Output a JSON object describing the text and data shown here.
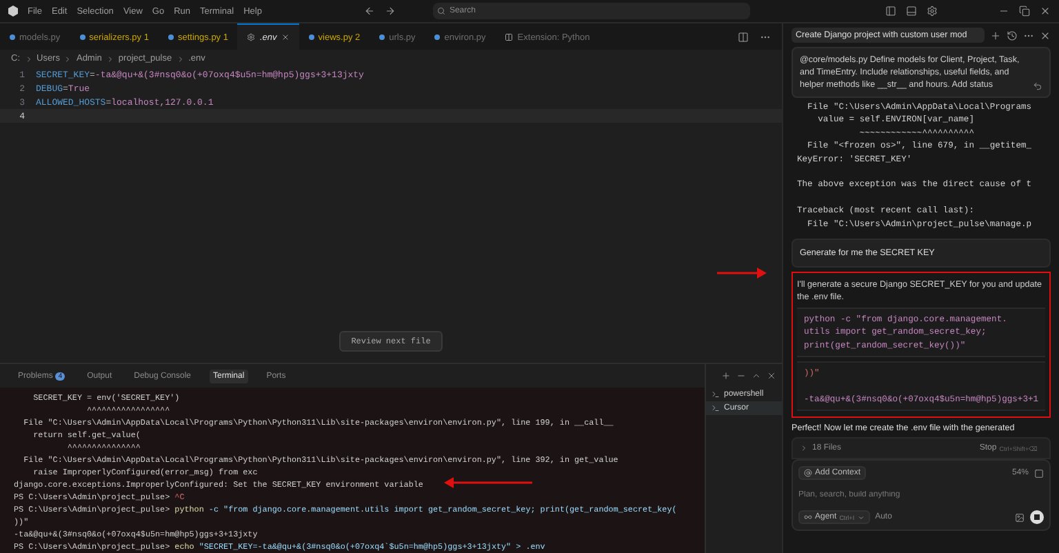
{
  "menu": [
    "File",
    "Edit",
    "Selection",
    "View",
    "Go",
    "Run",
    "Terminal",
    "Help"
  ],
  "search": {
    "placeholder": "Search"
  },
  "tabs": [
    {
      "label": "models.py",
      "kind": "dim",
      "selected": false
    },
    {
      "label": "serializers.py",
      "kind": "warning",
      "count": "1",
      "selected": false
    },
    {
      "label": "settings.py",
      "kind": "warning",
      "count": "1",
      "selected": false
    },
    {
      "label": ".env",
      "kind": "env",
      "selected": true
    },
    {
      "label": "views.py",
      "kind": "warning",
      "count": "2",
      "selected": false
    },
    {
      "label": "urls.py",
      "kind": "dim",
      "selected": false
    },
    {
      "label": "environ.py",
      "kind": "dim",
      "selected": false
    },
    {
      "label": "Extension: Python",
      "kind": "extension",
      "selected": false
    }
  ],
  "breadcrumb": [
    "C:",
    "Users",
    "Admin",
    "project_pulse",
    ".env"
  ],
  "editor_lines": [
    {
      "number": "1",
      "key": "SECRET_KEY",
      "separator": "=",
      "value": "-ta&@qu+&(3#nsq0&o(+07oxq4$u5n=hm@hp5)ggs+3+13jxty",
      "current": false
    },
    {
      "number": "2",
      "key": "DEBUG",
      "separator": "=",
      "value": "True",
      "current": false
    },
    {
      "number": "3",
      "key": "ALLOWED_HOSTS",
      "separator": "=",
      "value": "localhost,127.0.0.1",
      "current": false
    },
    {
      "number": "4",
      "current": true
    }
  ],
  "review_button": "Review next file",
  "panel_tabs": [
    {
      "label": "Problems",
      "badge": "4",
      "selected": false
    },
    {
      "label": "Output",
      "selected": false
    },
    {
      "label": "Debug Console",
      "selected": false
    },
    {
      "label": "Terminal",
      "selected": true
    },
    {
      "label": "Ports",
      "selected": false
    }
  ],
  "terminal_lines": [
    {
      "kind": "output",
      "text": "    SECRET_KEY = env('SECRET_KEY')"
    },
    {
      "kind": "output",
      "text": "               ^^^^^^^^^^^^^^^^^"
    },
    {
      "kind": "output",
      "text": "  File \"C:\\Users\\Admin\\AppData\\Local\\Programs\\Python\\Python311\\Lib\\site-packages\\environ\\environ.py\", line 199, in __call__"
    },
    {
      "kind": "output",
      "text": "    return self.get_value("
    },
    {
      "kind": "output",
      "text": "           ^^^^^^^^^^^^^^^"
    },
    {
      "kind": "output",
      "text": "  File \"C:\\Users\\Admin\\AppData\\Local\\Programs\\Python\\Python311\\Lib\\site-packages\\environ\\environ.py\", line 392, in get_value"
    },
    {
      "kind": "output",
      "text": "    raise ImproperlyConfigured(error_msg) from exc"
    },
    {
      "kind": "output",
      "text": "django.core.exceptions.ImproperlyConfigured: Set the SECRET_KEY environment variable"
    },
    {
      "kind": "prompt",
      "prompt": "PS C:\\Users\\Admin\\project_pulse>",
      "program": "^C"
    },
    {
      "kind": "prompt",
      "prompt": "PS C:\\Users\\Admin\\project_pulse>",
      "program": "python",
      "args": "-c \"from django.core.management.utils import get_random_secret_key; print(get_random_secret_key("
    },
    {
      "kind": "output",
      "text": "))\""
    },
    {
      "kind": "output",
      "text": "-ta&@qu+&(3#nsq0&o(+07oxq4$u5n=hm@hp5)ggs+3+13jxty"
    },
    {
      "kind": "prompt",
      "prompt": "PS C:\\Users\\Admin\\project_pulse>",
      "program": "echo",
      "args": "\"SECRET_KEY=-ta&@qu+&(3#nsq0&o(+07oxq4`$u5n=hm@hp5)ggs+3+13jxty\" > .env"
    }
  ],
  "terminals": [
    {
      "label": "powershell",
      "selected": false
    },
    {
      "label": "Cursor",
      "selected": true
    }
  ],
  "chat": {
    "title": "Create Django project with custom user mod",
    "prompt": "@core/models.py Define models for Client, Project, Task, and TimeEntry. Include relationships, useful fields, and helper methods like __str__ and hours. Add status",
    "traceback_blocks": [
      [
        "  File \"C:\\Users\\Admin\\AppData\\Local\\Programs",
        "    value = self.ENVIRON[var_name]",
        "            ~~~~~~~~~~~~^^^^^^^^^^",
        "  File \"<frozen os>\", line 679, in __getitem_",
        "KeyError: 'SECRET_KEY'"
      ],
      [
        "The above exception was the direct cause of t"
      ],
      [
        "Traceback (most recent call last):",
        "  File \"C:\\Users\\Admin\\project_pulse\\manage.p"
      ]
    ],
    "request": "Generate for me the SECRET KEY",
    "reply": "I'll generate a secure Django SECRET_KEY for you and update the .env file.",
    "command": [
      "python -c \"from django.core.management.",
      "utils import get_random_secret_key;",
      "print(get_random_secret_key())\""
    ],
    "output": [
      "))\"",
      "-ta&@qu+&(3#nsq0&o(+07oxq4$u5n=hm@hp5)ggs+3+1"
    ],
    "followup": "Perfect! Now let me create the .env file with the generated",
    "files": "18 Files",
    "stop": "Stop",
    "stop_shortcut": "Ctrl+Shift+⌫",
    "add_context": "Add Context",
    "usage": "54%",
    "placeholder": "Plan, search, build anything",
    "mode": "Agent",
    "mode_shortcut": "Ctrl+I",
    "model": "Auto"
  }
}
